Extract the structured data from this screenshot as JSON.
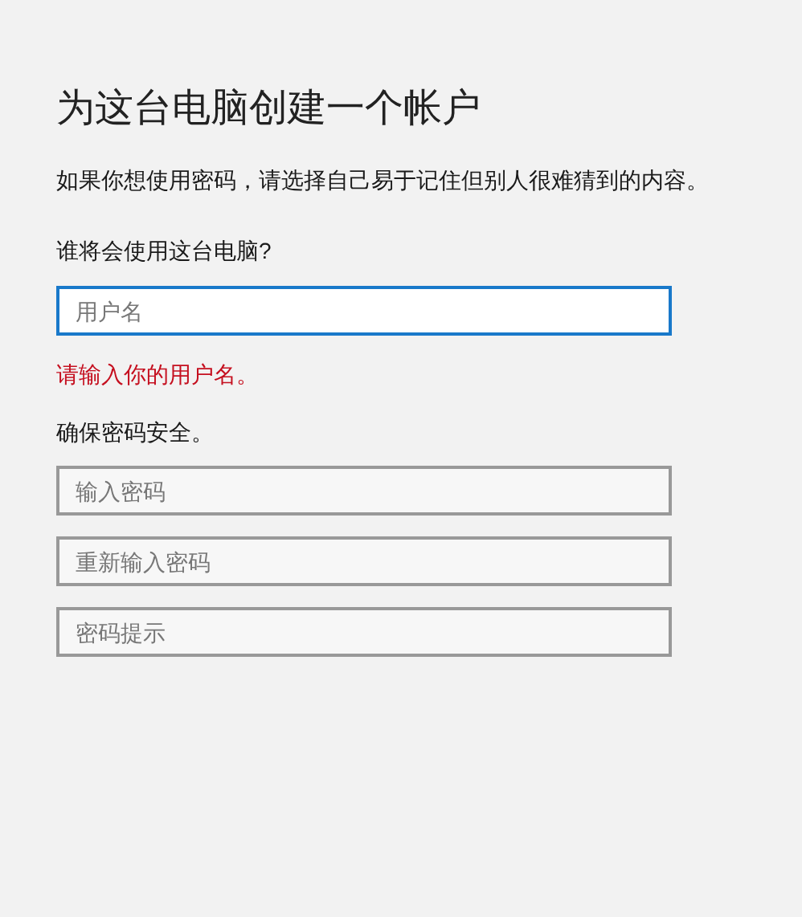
{
  "title": "为这台电脑创建一个帐户",
  "description": "如果你想使用密码，请选择自己易于记住但别人很难猜到的内容。",
  "user_section": {
    "label": "谁将会使用这台电脑?",
    "field": {
      "placeholder": "用户名",
      "focused": true
    },
    "error": "请输入你的用户名。"
  },
  "password_section": {
    "label": "确保密码安全。",
    "fields": [
      {
        "placeholder": "输入密码",
        "focused": false
      },
      {
        "placeholder": "重新输入密码",
        "focused": false
      },
      {
        "placeholder": "密码提示",
        "focused": false
      }
    ]
  }
}
